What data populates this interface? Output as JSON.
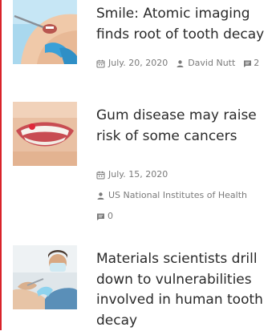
{
  "articles": [
    {
      "title": "Smile: Atomic imaging finds root of tooth decay",
      "date": "July. 20, 2020",
      "author": "David Nutt",
      "comments": "2",
      "thumb": "dental-exam-photo"
    },
    {
      "title": "Gum disease may raise risk of some cancers",
      "date": "July. 15, 2020",
      "author": "US National Institutes of Health",
      "comments": "0",
      "thumb": "smiling-mouth-photo"
    },
    {
      "title": "Materials scientists drill down to vulnerabilities involved in human tooth decay",
      "thumb": "dentist-with-patient-photo"
    }
  ],
  "colors": {
    "accent_rule": "#d9222a",
    "headline": "#2a2a2a",
    "meta": "#7a7a7a"
  },
  "icons": {
    "date": "calendar-icon",
    "author": "user-icon",
    "comments": "comment-icon"
  }
}
